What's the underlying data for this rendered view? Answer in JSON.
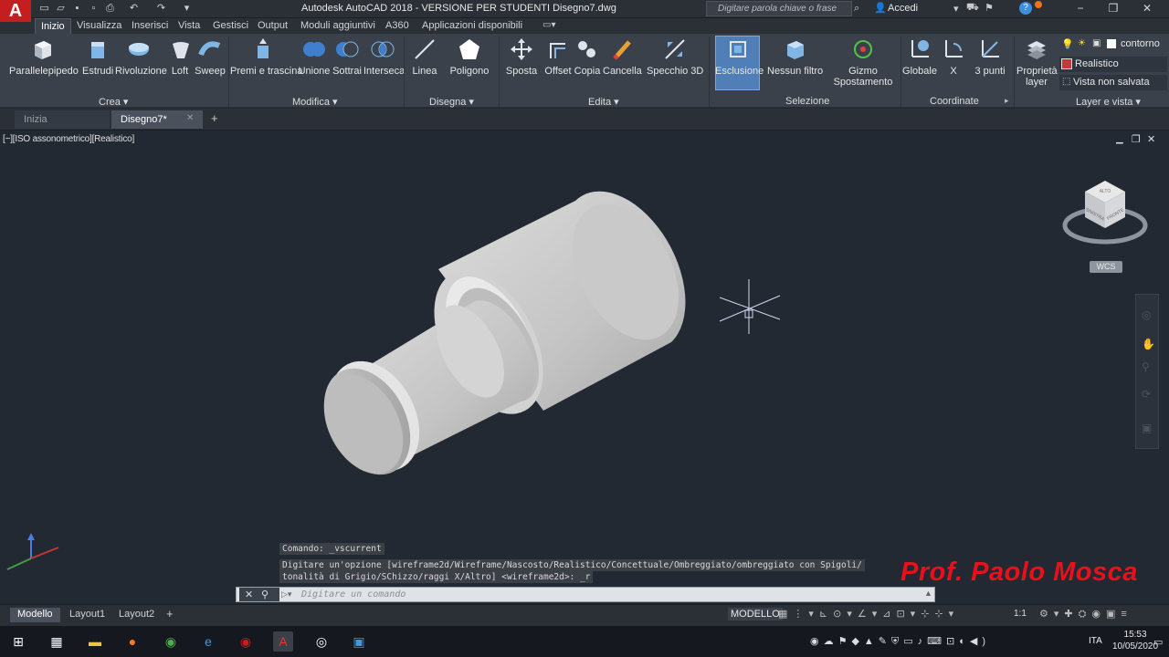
{
  "app": {
    "title": "Autodesk AutoCAD 2018 - VERSIONE PER STUDENTI   Disegno7.dwg",
    "search_placeholder": "Digitare parola chiave o frase",
    "login": "Accedi",
    "logo": "A"
  },
  "menu_tabs": [
    "Inizio",
    "Visualizza",
    "Inserisci",
    "Vista",
    "Gestisci",
    "Output",
    "Moduli aggiuntivi",
    "A360",
    "Applicazioni disponibili"
  ],
  "ribbon": {
    "crea": {
      "title": "Crea",
      "buttons": [
        "Parallelepipedo",
        "Estrudi",
        "Rivoluzione",
        "Loft",
        "Sweep"
      ]
    },
    "modifica": {
      "title": "Modifica",
      "buttons": [
        "Premi e trascina",
        "Unione",
        "Sottrai",
        "Interseca"
      ]
    },
    "disegna": {
      "title": "Disegna",
      "buttons": [
        "Linea",
        "Poligono"
      ]
    },
    "edita": {
      "title": "Edita",
      "buttons": [
        "Sposta",
        "Offset",
        "Copia",
        "Cancella",
        "Specchio 3D"
      ]
    },
    "selezione": {
      "title": "Selezione",
      "buttons": [
        "Esclusione",
        "Nessun filtro",
        "Gizmo Spostamento"
      ]
    },
    "coordinate": {
      "title": "Coordinate",
      "buttons": [
        "Globale",
        "X",
        "3 punti"
      ]
    },
    "layer": {
      "title": "Layer e vista",
      "prop_label": "Proprietà layer",
      "layer_name": "contorno",
      "visual_style": "Realistico",
      "view": "Vista non salvata"
    }
  },
  "doc_tabs": [
    "Inizia",
    "Disegno7*"
  ],
  "viewport": {
    "label": "[−][ISO assonometrico][Realistico]",
    "viewcube_top": "ALTO",
    "viewcube_left": "SINISTRA",
    "viewcube_front": "FRONTE",
    "wcs": "WCS"
  },
  "command": {
    "history": [
      "Comando: _vscurrent",
      "Digitare un'opzione [wireframe2d/Wireframe/Nascosto/Realistico/Concettuale/Ombreggiato/ombreggiato con Spigoli/",
      "tonalità di Grigio/SChizzo/raggi X/Altro] <wireframe2d>: _r"
    ],
    "placeholder": "Digitare un comando"
  },
  "watermark": "Prof. Paolo Mosca",
  "layout_tabs": [
    "Modello",
    "Layout1",
    "Layout2"
  ],
  "status": {
    "model": "MODELLO",
    "scale": "1:1"
  },
  "taskbar": {
    "lang": "ITA",
    "time": "15:53",
    "date": "10/05/2020"
  },
  "colors": {
    "accent": "#c41e1e",
    "viewport_bg": "#222933",
    "ribbon_bg": "#3b414b",
    "watermark": "#e8101a"
  }
}
